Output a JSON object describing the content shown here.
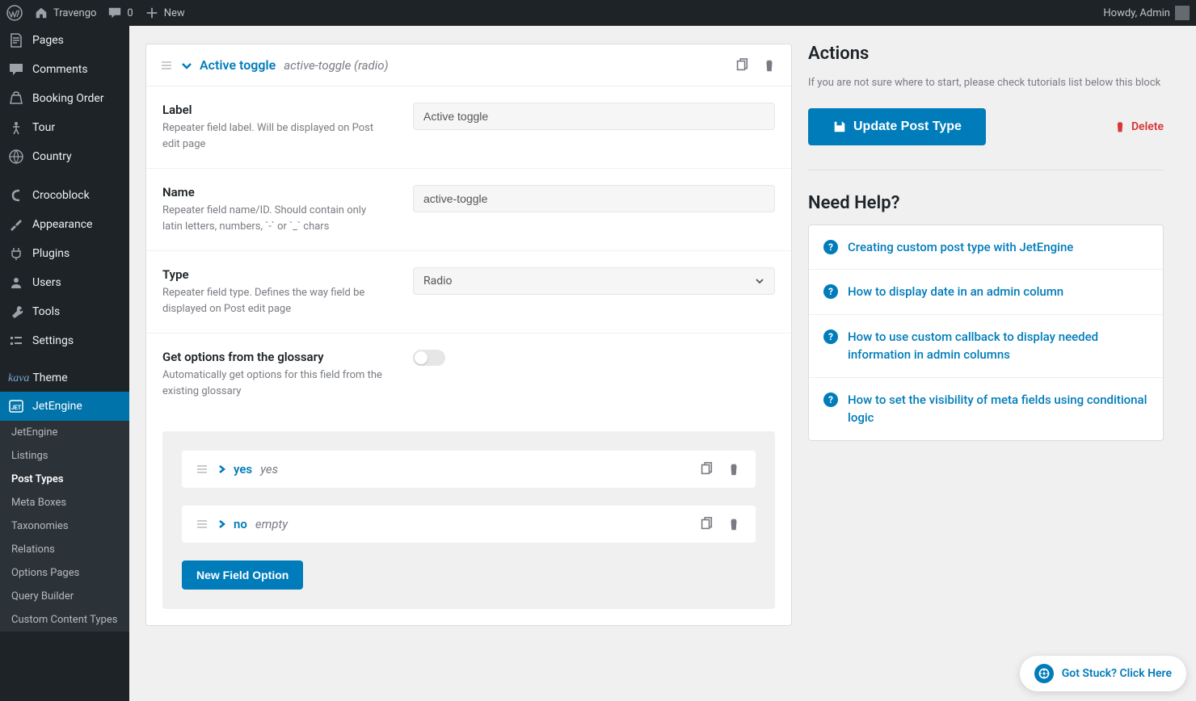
{
  "adminbar": {
    "site": "Travengo",
    "comments": "0",
    "new": "New",
    "howdy": "Howdy, Admin"
  },
  "sidebar": {
    "items": [
      {
        "label": "Pages"
      },
      {
        "label": "Comments"
      },
      {
        "label": "Booking Order"
      },
      {
        "label": "Tour"
      },
      {
        "label": "Country"
      },
      {
        "label": "Crocoblock"
      },
      {
        "label": "Appearance"
      },
      {
        "label": "Plugins"
      },
      {
        "label": "Users"
      },
      {
        "label": "Tools"
      },
      {
        "label": "Settings"
      },
      {
        "label": "Theme"
      },
      {
        "label": "JetEngine"
      }
    ],
    "subs": [
      {
        "label": "JetEngine"
      },
      {
        "label": "Listings"
      },
      {
        "label": "Post Types"
      },
      {
        "label": "Meta Boxes"
      },
      {
        "label": "Taxonomies"
      },
      {
        "label": "Relations"
      },
      {
        "label": "Options Pages"
      },
      {
        "label": "Query Builder"
      },
      {
        "label": "Custom Content Types"
      }
    ]
  },
  "panel": {
    "title": "Active toggle",
    "subtitle": "active-toggle (radio)",
    "fields": {
      "label": {
        "title": "Label",
        "desc": "Repeater field label. Will be displayed on Post edit page",
        "value": "Active toggle"
      },
      "name": {
        "title": "Name",
        "desc": "Repeater field name/ID. Should contain only latin letters, numbers, `-` or `_` chars",
        "value": "active-toggle"
      },
      "type": {
        "title": "Type",
        "desc": "Repeater field type. Defines the way field be displayed on Post edit page",
        "value": "Radio"
      },
      "glossary": {
        "title": "Get options from the glossary",
        "desc": "Automatically get options for this field from the existing glossary"
      }
    },
    "options": [
      {
        "title": "yes",
        "sub": "yes"
      },
      {
        "title": "no",
        "sub": "empty"
      }
    ],
    "new_option_btn": "New Field Option"
  },
  "side": {
    "actions_title": "Actions",
    "actions_desc": "If you are not sure where to start, please check tutorials list below this block",
    "update_btn": "Update Post Type",
    "delete_btn": "Delete",
    "help_title": "Need Help?",
    "help_items": [
      "Creating custom post type with JetEngine",
      "How to display date in an admin column",
      "How to use custom callback to display needed information in admin columns",
      "How to set the visibility of meta fields using conditional logic"
    ]
  },
  "got_stuck": "Got Stuck? Click Here"
}
